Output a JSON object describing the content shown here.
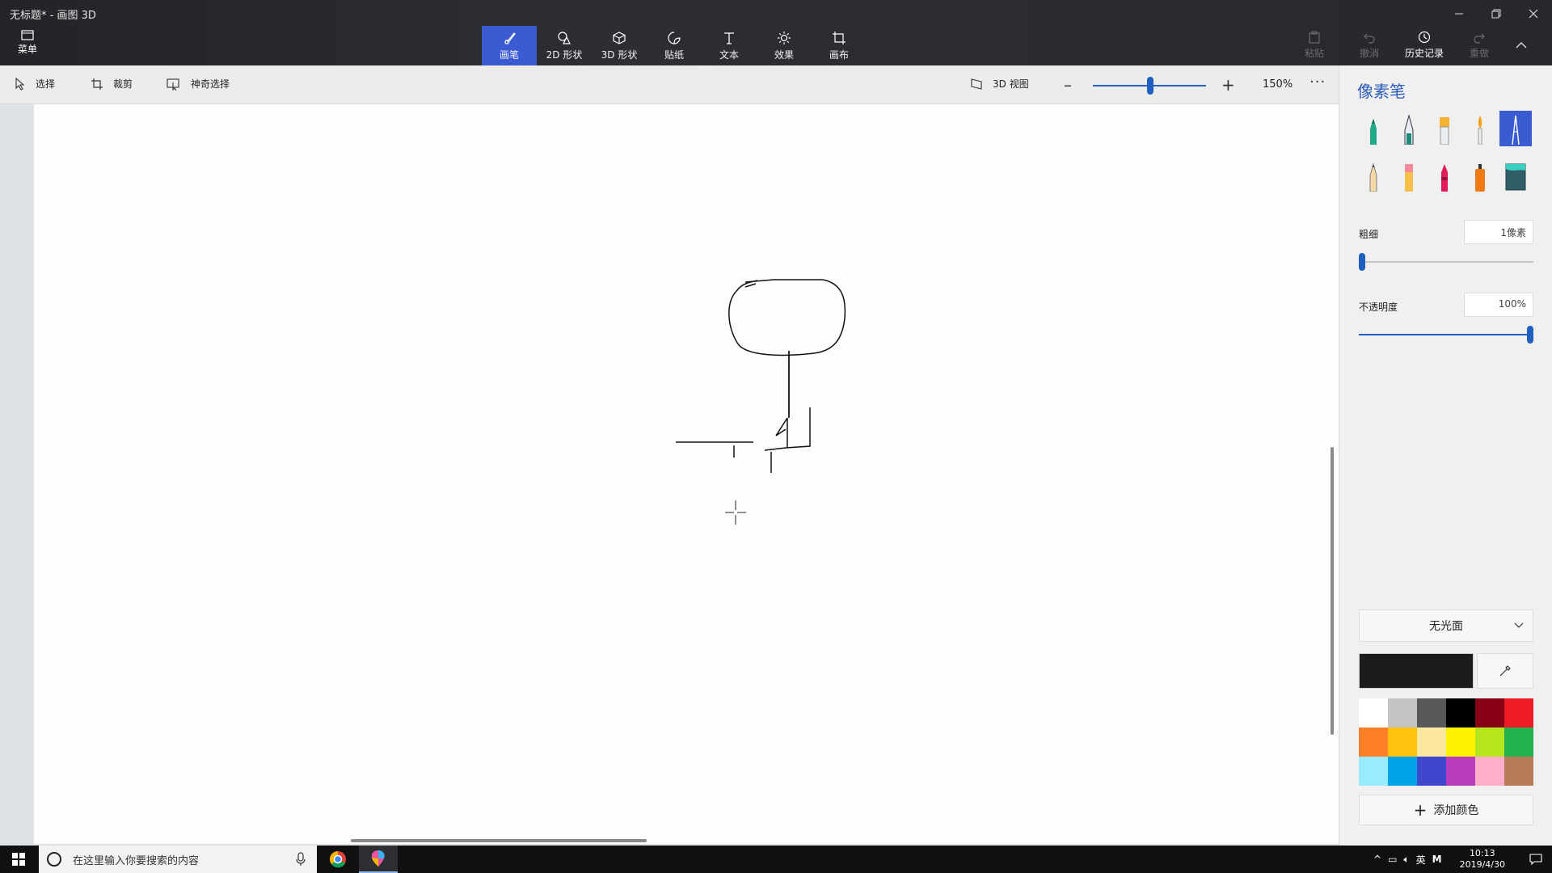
{
  "window": {
    "title": "无标题* - 画图 3D"
  },
  "menu": {
    "label": "菜单"
  },
  "toolbar": {
    "tools": [
      {
        "id": "brushes",
        "label": "画笔",
        "icon": "brush-icon",
        "active": true
      },
      {
        "id": "shapes2d",
        "label": "2D 形状",
        "icon": "shapes-2d-icon",
        "active": false
      },
      {
        "id": "shapes3d",
        "label": "3D 形状",
        "icon": "cube-icon",
        "active": false
      },
      {
        "id": "stickers",
        "label": "贴纸",
        "icon": "sticker-icon",
        "active": false
      },
      {
        "id": "text",
        "label": "文本",
        "icon": "text-icon",
        "active": false
      },
      {
        "id": "effects",
        "label": "效果",
        "icon": "sun-icon",
        "active": false
      },
      {
        "id": "canvas",
        "label": "画布",
        "icon": "canvas-icon",
        "active": false
      }
    ],
    "right": [
      {
        "label": "粘贴",
        "enabled": false
      },
      {
        "label": "撤消",
        "enabled": false
      },
      {
        "label": "历史记录",
        "enabled": true
      },
      {
        "label": "重做",
        "enabled": false
      }
    ]
  },
  "subbar": {
    "select": "选择",
    "crop": "裁剪",
    "magic_select": "神奇选择",
    "view3d": "3D 视图",
    "zoom": "150%",
    "zoom_level_fraction": 0.5
  },
  "panel": {
    "title": "像素笔",
    "brushes": [
      "marker-icon",
      "calligraphy-pen-icon",
      "oil-brush-icon",
      "watercolor-icon",
      "pixel-pen-icon",
      "pencil-icon",
      "eraser-icon",
      "crayon-icon",
      "spray-can-icon",
      "fill-bucket-icon"
    ],
    "active_brush": "pixel-pen-icon",
    "thickness": {
      "label": "粗细",
      "value": "1像素",
      "fraction": 0.0
    },
    "opacity": {
      "label": "不透明度",
      "value": "100%",
      "fraction": 1.0
    },
    "finish": "无光面",
    "current_color": "#1c1c1c",
    "palette": [
      "#ffffff",
      "#c3c3c3",
      "#585858",
      "#000000",
      "#880015",
      "#ed1c24",
      "#ff7f27",
      "#ffc20e",
      "#fde8a0",
      "#fff200",
      "#b5e61d",
      "#22b14c",
      "#99ecff",
      "#00a2e8",
      "#3f48cc",
      "#b83dba",
      "#ffaec9",
      "#b97a57"
    ],
    "add_color": "添加颜色"
  },
  "taskbar": {
    "search_placeholder": "在这里输入你要搜索的内容",
    "ime": "英",
    "time": "10:13",
    "date": "2019/4/30"
  }
}
